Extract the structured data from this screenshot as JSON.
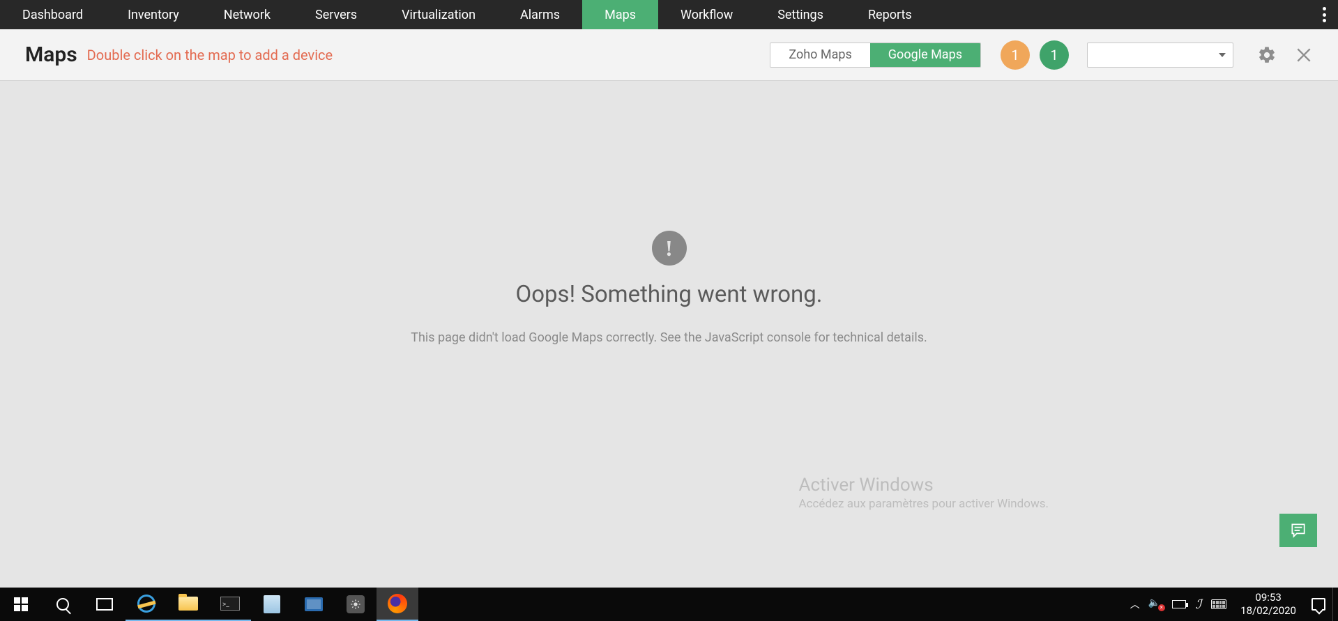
{
  "nav": {
    "items": [
      {
        "label": "Dashboard"
      },
      {
        "label": "Inventory"
      },
      {
        "label": "Network"
      },
      {
        "label": "Servers"
      },
      {
        "label": "Virtualization"
      },
      {
        "label": "Alarms"
      },
      {
        "label": "Maps",
        "active": true
      },
      {
        "label": "Workflow"
      },
      {
        "label": "Settings"
      },
      {
        "label": "Reports"
      }
    ]
  },
  "subheader": {
    "title": "Maps",
    "hint": "Double click on the map to add a device",
    "toggle": {
      "zoho": "Zoho Maps",
      "google": "Google Maps"
    },
    "badges": {
      "orange": "1",
      "green": "1"
    },
    "dropdown_value": ""
  },
  "error": {
    "title": "Oops! Something went wrong.",
    "subtitle": "This page didn't load Google Maps correctly. See the JavaScript console for technical details."
  },
  "watermark": {
    "title": "Activer Windows",
    "sub": "Accédez aux paramètres pour activer Windows."
  },
  "taskbar": {
    "time": "09:53",
    "date": "18/02/2020"
  }
}
